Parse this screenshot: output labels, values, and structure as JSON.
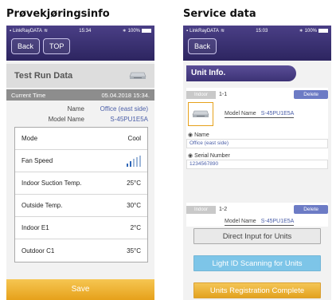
{
  "captions": {
    "left": "Prøvekjøringsinfo",
    "right": "Service data"
  },
  "left_screen": {
    "status": {
      "carrier": "LinkRayDATA",
      "time": "15:34",
      "battery": "100%"
    },
    "nav": {
      "back": "Back",
      "top": "TOP"
    },
    "title": "Test Run Data",
    "current_time_label": "Current Time",
    "current_time_value": "05.04.2018 15:34.",
    "name_label": "Name",
    "name_value": "Office (east side)",
    "model_label": "Model Name",
    "model_value": "S-45PU1E5A",
    "rows": [
      {
        "label": "Mode",
        "value": "Cool"
      },
      {
        "label": "Fan Speed",
        "value": ""
      },
      {
        "label": "Indoor Suction Temp.",
        "value": "25°C"
      },
      {
        "label": "Outside Temp.",
        "value": "30°C"
      },
      {
        "label": "Indoor E1",
        "value": "2°C"
      },
      {
        "label": "Outdoor C1",
        "value": "35°C"
      }
    ],
    "fan_speed_level": 0.4,
    "save": "Save"
  },
  "right_screen": {
    "status": {
      "carrier": "LinkRayDATA",
      "time": "15:03",
      "battery": "100%"
    },
    "nav": {
      "back": "Back"
    },
    "section": "Unit Info.",
    "unit1": {
      "tag": "Indoor",
      "id": "1-1",
      "delete": "Delete",
      "model_label": "Model Name",
      "model_value": "S-45PU1E5A",
      "name_label": "Name",
      "name_value": "Office (east side)",
      "serial_label": "Serial Number",
      "serial_value": "1234567890"
    },
    "unit2": {
      "tag": "Indoor",
      "id": "1-2",
      "delete": "Delete",
      "model_label": "Model Name",
      "model_value": "S-45PU1E5A"
    },
    "buttons": {
      "direct_input": "Direct Input for Units",
      "light_id": "Light ID Scanning for Units",
      "complete": "Units Registration Complete"
    }
  }
}
